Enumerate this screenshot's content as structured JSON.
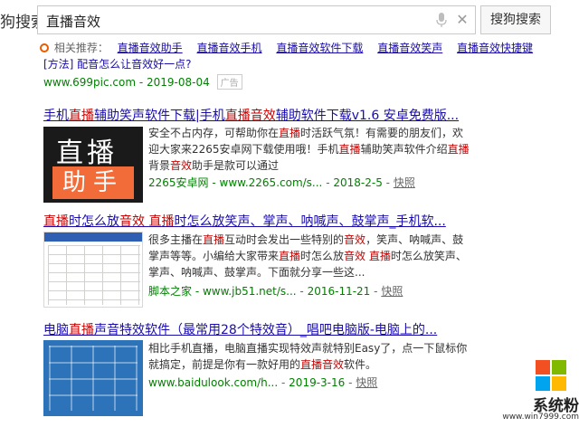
{
  "header": {
    "logo_text": "狗搜索",
    "search_value": "直播音效",
    "search_button": "搜狗搜索"
  },
  "related": {
    "label": "相关推荐：",
    "items": [
      "直播音效助手",
      "直播音效手机",
      "直播音效软件下载",
      "直播音效笑声",
      "直播音效快捷键"
    ]
  },
  "stub": {
    "text": "[方法] 配音怎么让音效好一点?",
    "url": "www.699pic.com - 2019-08-04",
    "ad": "广告"
  },
  "results": [
    {
      "title": [
        {
          "t": "手机",
          "h": false
        },
        {
          "t": "直播",
          "h": true
        },
        {
          "t": "辅助笑声软件下载|手机",
          "h": false
        },
        {
          "t": "直播音效",
          "h": true
        },
        {
          "t": "辅助软件下载v1.6 安卓免费版...",
          "h": false
        }
      ],
      "thumb_text_1": "直播",
      "thumb_text_2": "助手",
      "snippet": [
        {
          "t": "安全不占内存，可帮助你在",
          "h": false
        },
        {
          "t": "直播",
          "h": true
        },
        {
          "t": "时活跃气氛！有需要的朋友们，欢迎大家来2265安卓网下载使用哦！手机",
          "h": false
        },
        {
          "t": "直播",
          "h": true
        },
        {
          "t": "辅助笑声软件介绍",
          "h": false
        },
        {
          "t": "直播",
          "h": true
        },
        {
          "t": "背景",
          "h": false
        },
        {
          "t": "音效",
          "h": true
        },
        {
          "t": "助手是款可以通过",
          "h": false
        }
      ],
      "source": "2265安卓网 - www.2265.com/s...",
      "date": "2018-2-5",
      "snapshot": "快照"
    },
    {
      "title": [
        {
          "t": "直播",
          "h": true
        },
        {
          "t": "时怎么放",
          "h": false
        },
        {
          "t": "音效",
          "h": true
        },
        {
          "t": " ",
          "h": false
        },
        {
          "t": "直播",
          "h": true
        },
        {
          "t": "时怎么放笑声、掌声、呐喊声、鼓掌声_手机软...",
          "h": false
        }
      ],
      "snippet": [
        {
          "t": "很多主播在",
          "h": false
        },
        {
          "t": "直播",
          "h": true
        },
        {
          "t": "互动时会发出一些特别的",
          "h": false
        },
        {
          "t": "音效",
          "h": true
        },
        {
          "t": "，笑声、呐喊声、鼓掌声等等。小编给大家带来",
          "h": false
        },
        {
          "t": "直播",
          "h": true
        },
        {
          "t": "时怎么放",
          "h": false
        },
        {
          "t": "音效",
          "h": true
        },
        {
          "t": " ",
          "h": false
        },
        {
          "t": "直播",
          "h": true
        },
        {
          "t": "时怎么放笑声、掌声、呐喊声、鼓掌声。下面就分享一些这...",
          "h": false
        }
      ],
      "source": "脚本之家 - www.jb51.net/s...",
      "date": "2016-11-21",
      "snapshot": "快照"
    },
    {
      "title": [
        {
          "t": "电脑",
          "h": false
        },
        {
          "t": "直播",
          "h": true
        },
        {
          "t": "声音特效软件（最常用28个特效音）_唱吧电脑版-电脑上的...",
          "h": false
        }
      ],
      "snippet": [
        {
          "t": "相比手机直播，电脑直播实现特效声就特别Easy了，点一下鼠标你就搞定，前提是你有一款好用的",
          "h": false
        },
        {
          "t": "直播音效",
          "h": true
        },
        {
          "t": "软件。",
          "h": false
        }
      ],
      "source": "www.baidulook.com/h...",
      "date": "2019-3-16",
      "snapshot": "快照"
    }
  ],
  "watermark": {
    "brand": "系统粉",
    "url": "www.win7999.com",
    "colors": [
      "#f25022",
      "#7fba00",
      "#00a4ef",
      "#ffb900"
    ]
  },
  "icons": [
    "search-related-icon",
    "mic-icon",
    "clear-icon",
    "windows-logo-icon"
  ]
}
